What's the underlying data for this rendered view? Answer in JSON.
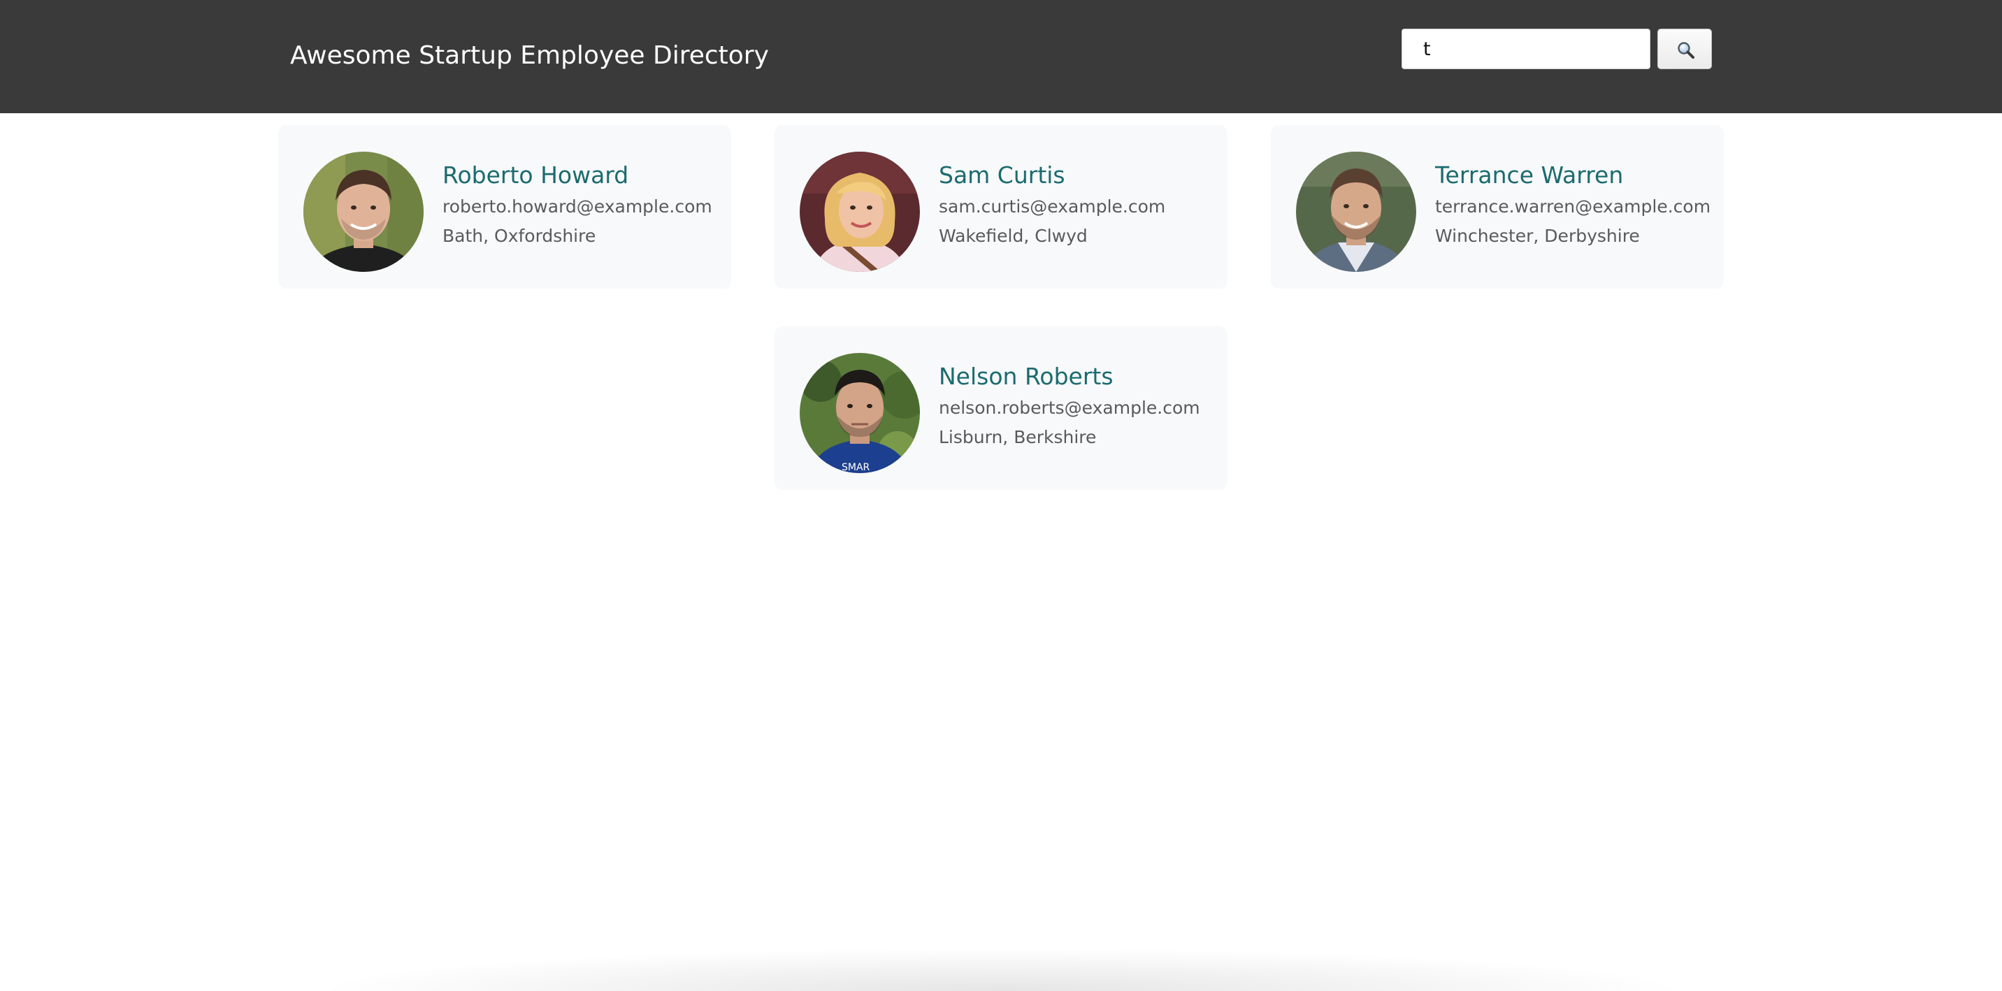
{
  "header": {
    "title": "Awesome Startup Employee Directory"
  },
  "search": {
    "value": "t",
    "placeholder": "",
    "button_icon": "magnifier-icon"
  },
  "employees": [
    {
      "name": "Roberto Howard",
      "email": "roberto.howard@example.com",
      "location": "Bath, Oxfordshire"
    },
    {
      "name": "Sam Curtis",
      "email": "sam.curtis@example.com",
      "location": "Wakefield, Clwyd"
    },
    {
      "name": "Terrance Warren",
      "email": "terrance.warren@example.com",
      "location": "Winchester, Derbyshire"
    },
    {
      "name": "Nelson Roberts",
      "email": "nelson.roberts@example.com",
      "location": "Lisburn, Berkshire"
    }
  ],
  "colors": {
    "header_bg": "#3a3a3a",
    "name": "#1b6b6e",
    "card_bg": "#f8f9fb",
    "detail_text": "#5a5a5a"
  }
}
